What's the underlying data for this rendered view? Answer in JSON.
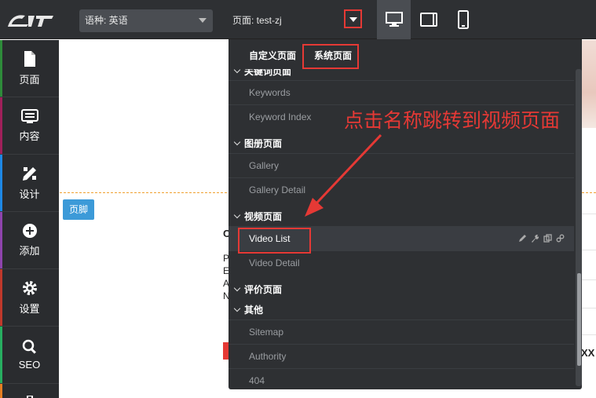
{
  "topbar": {
    "language_select": "语种:  英语",
    "page_select": "页面:  test-zj",
    "devices": [
      "desktop-icon",
      "tablet-icon",
      "mobile-icon"
    ]
  },
  "sidebar": {
    "items": [
      {
        "label": "页面",
        "icon": "page-icon",
        "color": "#2e8b3a"
      },
      {
        "label": "内容",
        "icon": "content-icon",
        "color": "#a0205a"
      },
      {
        "label": "设计",
        "icon": "design-icon",
        "color": "#1e88e5"
      },
      {
        "label": "添加",
        "icon": "add-icon",
        "color": "#8e44ad"
      },
      {
        "label": "设置",
        "icon": "settings-icon",
        "color": "#c0392b"
      },
      {
        "label": "SEO",
        "icon": "search-icon",
        "color": "#27ae60"
      }
    ]
  },
  "canvas": {
    "footer_badge": "页脚",
    "letters": [
      "C",
      "P",
      "E",
      "A",
      "N"
    ],
    "xx": "XX"
  },
  "dropdown": {
    "tabs": [
      "自定义页面",
      "系统页面"
    ],
    "groups": [
      {
        "title": "关键词页面",
        "items": [
          "Keywords",
          "Keyword Index"
        ]
      },
      {
        "title": "图册页面",
        "items": [
          "Gallery",
          "Gallery Detail"
        ]
      },
      {
        "title": "视频页面",
        "items": [
          "Video List",
          "Video Detail"
        ]
      },
      {
        "title": "评价页面",
        "items": []
      },
      {
        "title": "其他",
        "items": [
          "Sitemap",
          "Authority",
          "404"
        ]
      }
    ]
  },
  "annotation": "点击名称跳转到视频页面",
  "colors": {
    "highlight": "#e53935",
    "accent": "#3c9ad8"
  }
}
